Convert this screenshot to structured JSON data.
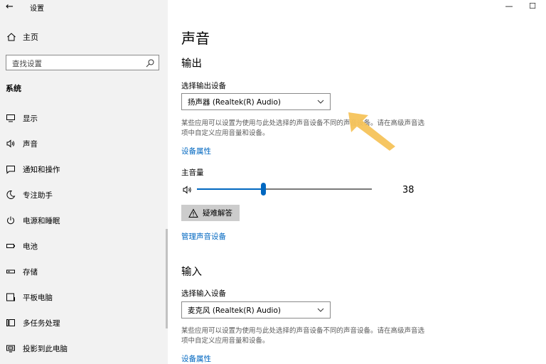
{
  "window": {
    "back_glyph": "←",
    "app_title": "设置",
    "minimize_glyph": "—",
    "maximize_glyph": "☐"
  },
  "sidebar": {
    "home_label": "主页",
    "search_placeholder": "查找设置",
    "section_title": "系统",
    "items": [
      {
        "label": "显示",
        "icon": "monitor-icon"
      },
      {
        "label": "声音",
        "icon": "speaker-icon"
      },
      {
        "label": "通知和操作",
        "icon": "notification-icon"
      },
      {
        "label": "专注助手",
        "icon": "moon-icon"
      },
      {
        "label": "电源和睡眠",
        "icon": "power-icon"
      },
      {
        "label": "电池",
        "icon": "battery-icon"
      },
      {
        "label": "存储",
        "icon": "storage-icon"
      },
      {
        "label": "平板电脑",
        "icon": "tablet-icon"
      },
      {
        "label": "多任务处理",
        "icon": "multitask-icon"
      },
      {
        "label": "投影到此电脑",
        "icon": "project-icon"
      }
    ]
  },
  "main": {
    "page_title": "声音",
    "output": {
      "heading": "输出",
      "select_label": "选择输出设备",
      "selected_device": "扬声器 (Realtek(R) Audio)",
      "description": "某些应用可以设置为使用与此处选择的声音设备不同的声音设备。请在高级声音选项中自定义应用音量和设备。",
      "device_properties_link": "设备属性",
      "volume_label": "主音量",
      "volume_value": "38",
      "troubleshoot_label": "疑难解答",
      "manage_devices_link": "管理声音设备"
    },
    "input": {
      "heading": "输入",
      "select_label": "选择输入设备",
      "selected_device": "麦克风 (Realtek(R) Audio)",
      "description": "某些应用可以设置为使用与此处选择的声音设备不同的声音设备。请在高级声音选项中自定义应用音量和设备。",
      "device_properties_link": "设备属性"
    }
  },
  "colors": {
    "accent": "#0067c0",
    "sidebar_bg": "#f2f2f2",
    "annotation_arrow": "#f5c35a"
  }
}
